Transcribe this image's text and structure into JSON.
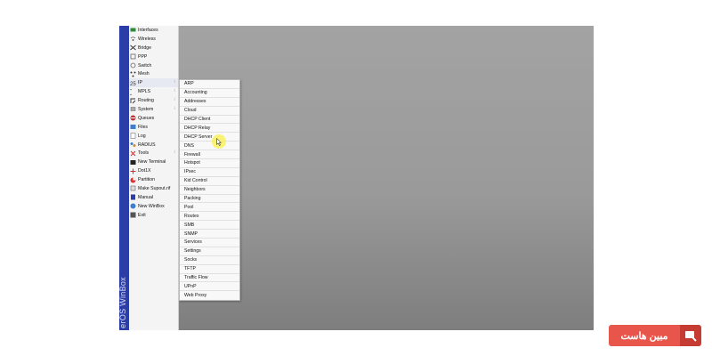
{
  "window": {
    "side_strip_text": "erOS WinBox"
  },
  "main_menu": {
    "items": [
      {
        "label": "Interfaces",
        "icon": "interfaces-icon"
      },
      {
        "label": "Wireless",
        "icon": "wireless-icon"
      },
      {
        "label": "Bridge",
        "icon": "bridge-icon"
      },
      {
        "label": "PPP",
        "icon": "ppp-icon"
      },
      {
        "label": "Switch",
        "icon": "switch-icon"
      },
      {
        "label": "Mesh",
        "icon": "mesh-icon"
      },
      {
        "label": "IP",
        "icon": "ip-icon",
        "submenu": true
      },
      {
        "label": "MPLS",
        "icon": "mpls-icon",
        "submenu": true
      },
      {
        "label": "Routing",
        "icon": "routing-icon",
        "submenu": true
      },
      {
        "label": "System",
        "icon": "system-icon",
        "submenu": true
      },
      {
        "label": "Queues",
        "icon": "queues-icon"
      },
      {
        "label": "Files",
        "icon": "files-icon"
      },
      {
        "label": "Log",
        "icon": "log-icon"
      },
      {
        "label": "RADIUS",
        "icon": "radius-icon"
      },
      {
        "label": "Tools",
        "icon": "tools-icon",
        "submenu": true
      },
      {
        "label": "New Terminal",
        "icon": "terminal-icon"
      },
      {
        "label": "Dot1X",
        "icon": "dot1x-icon"
      },
      {
        "label": "Partition",
        "icon": "partition-icon"
      },
      {
        "label": "Make Supout.rif",
        "icon": "supout-icon"
      },
      {
        "label": "Manual",
        "icon": "manual-icon"
      },
      {
        "label": "New WinBox",
        "icon": "winbox-icon"
      },
      {
        "label": "Exit",
        "icon": "exit-icon"
      }
    ],
    "submenu_arrow": "⁝"
  },
  "ip_submenu": {
    "items": [
      "ARP",
      "Accounting",
      "Addresses",
      "Cloud",
      "DHCP Client",
      "DHCP Relay",
      "DHCP Server",
      "DNS",
      "Firewall",
      "Hotspot",
      "IPsec",
      "Kid Control",
      "Neighbors",
      "Packing",
      "Pool",
      "Routes",
      "SMB",
      "SNMP",
      "Services",
      "Settings",
      "Socks",
      "TFTP",
      "Traffic Flow",
      "UPnP",
      "Web Proxy"
    ]
  },
  "brand": {
    "text": "مبین هاست"
  },
  "colors": {
    "strip": "#2b3ea8",
    "brand": "#e8554a",
    "brand_dark": "#c53d32",
    "cursor_highlight": "#faf03c"
  }
}
